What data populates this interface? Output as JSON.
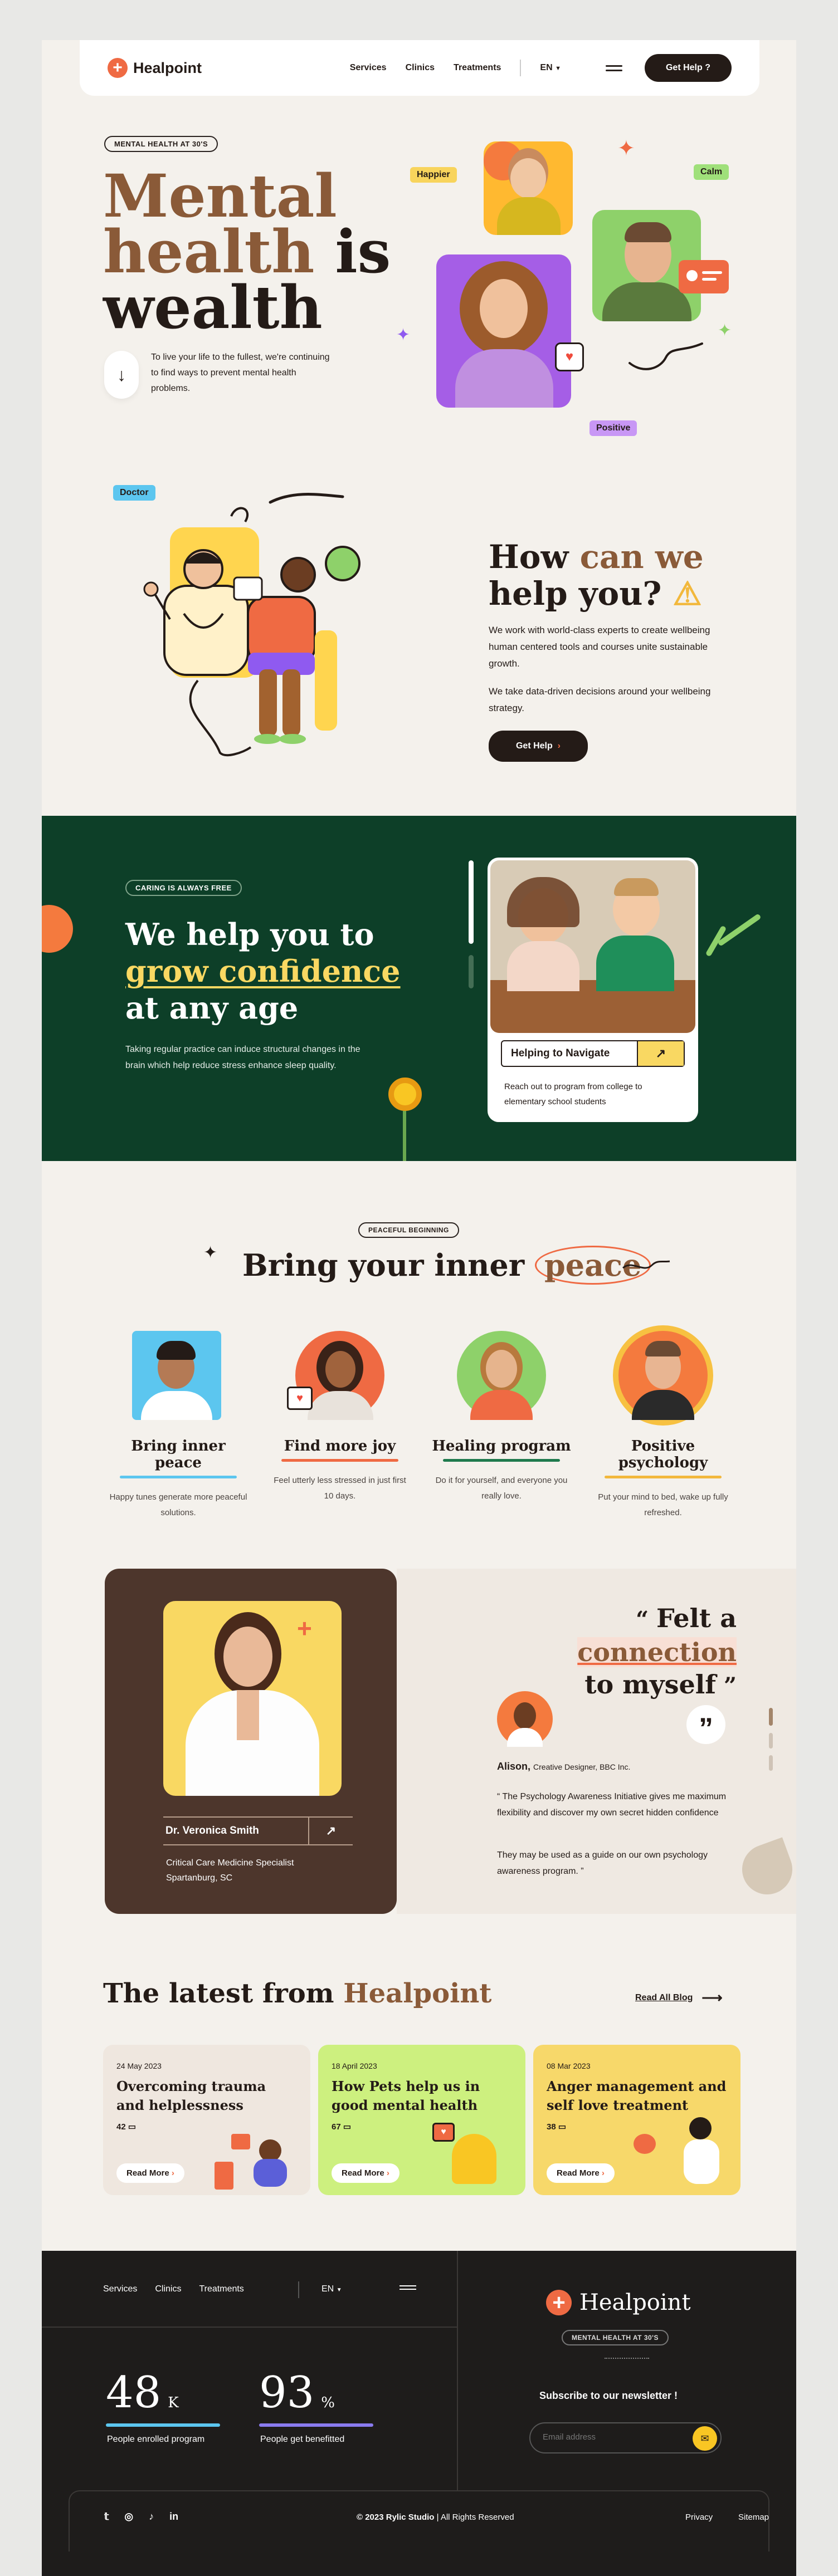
{
  "nav": {
    "brand": "Healpoint",
    "links": [
      "Services",
      "Clinics",
      "Treatments"
    ],
    "language": "EN",
    "cta": "Get Help ?"
  },
  "hero": {
    "eyebrow": "MENTAL HEALTH AT 30'S",
    "title_line1": "Mental",
    "title_line2a": "health",
    "title_line2b": " is",
    "title_line3": "wealth",
    "description": "To live your life to the fullest, we're continuing to find ways to prevent mental health problems.",
    "tags": {
      "happier": "Happier",
      "calm": "Calm",
      "positive": "Positive"
    }
  },
  "help": {
    "tag": "Doctor",
    "title_a": "How ",
    "title_b": "can we",
    "title_c": "help you?",
    "p1": "We work with world-class experts to create wellbeing human centered tools and courses unite sustainable growth.",
    "p2": "We take data-driven decisions around your wellbeing strategy.",
    "cta": "Get Help"
  },
  "confidence": {
    "eyebrow": "CARING IS ALWAYS FREE",
    "line1": "We help you to",
    "line2": "grow confidence",
    "line3": "at any age",
    "description": "Taking regular practice can induce structural changes in the brain which help reduce stress enhance sleep quality.",
    "card_title": "Helping to Navigate",
    "card_text": "Reach out to program from college to elementary school students"
  },
  "peace": {
    "eyebrow": "PEACEFUL BEGINNING",
    "title_a": "Bring your inner ",
    "title_b": "peace",
    "cards": [
      {
        "title": "Bring inner peace",
        "text": "Happy tunes generate more peaceful solutions.",
        "color": "#5cc6ef"
      },
      {
        "title": "Find more joy",
        "text": "Feel utterly less stressed in just first 10 days.",
        "color": "#ef6a43"
      },
      {
        "title": "Healing program",
        "text": "Do it for yourself, and everyone you really love.",
        "color": "#1f7a4d"
      },
      {
        "title": "Positive psychology",
        "text": "Put your mind to bed, wake up fully refreshed.",
        "color": "#f2b83c"
      }
    ]
  },
  "testimonial": {
    "doctor_name": "Dr. Veronica Smith",
    "doctor_role": "Critical Care Medicine Specialist",
    "doctor_location": "Spartanburg, SC",
    "quote_a": "Felt a ",
    "quote_b": "connection",
    "quote_c": "to myself",
    "author": "Alison,",
    "author_role": "Creative Designer, BBC Inc.",
    "p1": "“ The Psychology Awareness Initiative gives me maximum flexibility and discover my own secret hidden confidence",
    "p2": "They may be used as a guide on our own psychology awareness program. ”"
  },
  "blog": {
    "title_a": "The latest from ",
    "title_b": "Healpoint",
    "read_all": "Read All Blog",
    "posts": [
      {
        "date": "24 May 2023",
        "title": "Overcoming trauma and helplessness",
        "comments": "42",
        "cta": "Read More",
        "bg": "#efe7df"
      },
      {
        "date": "18 April 2023",
        "title": "How Pets help us in good mental health",
        "comments": "67",
        "cta": "Read More",
        "bg": "#cdf07f"
      },
      {
        "date": "08 Mar 2023",
        "title": "Anger management and self love treatment",
        "comments": "38",
        "cta": "Read More",
        "bg": "#f7d86a"
      }
    ]
  },
  "footer": {
    "links": [
      "Services",
      "Clinics",
      "Treatments"
    ],
    "language": "EN",
    "stats": [
      {
        "value": "48",
        "unit": "K",
        "label": "People enrolled program"
      },
      {
        "value": "93",
        "unit": "%",
        "label": "People get benefitted"
      }
    ],
    "brand": "Healpoint",
    "badge": "MENTAL HEALTH AT 30'S",
    "newsletter": "Subscribe to our newsletter !",
    "email_placeholder": "Email address",
    "copyright": "© 2023 Rylic Studio",
    "rights": " | All Rights Reserved",
    "privacy": "Privacy",
    "sitemap": "Sitemap"
  },
  "colors": {
    "accent": "#ef6a43",
    "brand_brown": "#8a5a38",
    "dark_green": "#0d3f28",
    "yellow": "#f9d862"
  }
}
